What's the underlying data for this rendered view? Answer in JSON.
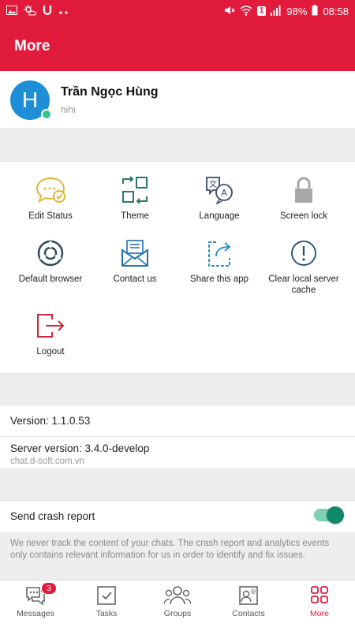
{
  "status_bar": {
    "battery": "98%",
    "time": "08:58",
    "sim_badge": "1",
    "left_icons": [
      "image-icon",
      "weather-icon",
      "u-icon",
      "more-dots-icon"
    ],
    "right_icons": [
      "mute-icon",
      "wifi-icon",
      "sim-icon",
      "signal-icon",
      "battery-icon"
    ]
  },
  "header": {
    "title": "More"
  },
  "profile": {
    "initial": "H",
    "name": "Trần Ngọc Hùng",
    "status": "hihi",
    "online": true
  },
  "menu": {
    "items": [
      {
        "label": "Edit Status",
        "icon": "chat-status-icon",
        "color": "#e0b43a"
      },
      {
        "label": "Theme",
        "icon": "theme-icon",
        "color": "#2a7a6a"
      },
      {
        "label": "Language",
        "icon": "language-icon",
        "color": "#3a4a6a"
      },
      {
        "label": "Screen lock",
        "icon": "lock-icon",
        "color": "#a8a8a8"
      },
      {
        "label": "Default browser",
        "icon": "browser-icon",
        "color": "#2c4a5a"
      },
      {
        "label": "Contact us",
        "icon": "mail-icon",
        "color": "#1f6fb5"
      },
      {
        "label": "Share this app",
        "icon": "share-icon",
        "color": "#2d8fc9"
      },
      {
        "label": "Clear local server cache",
        "icon": "info-icon",
        "color": "#1a4a7a"
      },
      {
        "label": "Logout",
        "icon": "logout-icon",
        "color": "#d0283c"
      }
    ]
  },
  "info": {
    "version": "Version: 1.1.0.53",
    "server_version": "Server version: 3.4.0-develop",
    "server_host": "chat.d-soft.com.vn"
  },
  "crash": {
    "label": "Send crash report",
    "enabled": true,
    "note": "We never track the content of your chats. The crash report and analytics events only contains relevant information for us in order to identify and fix issues."
  },
  "nav": {
    "items": [
      {
        "label": "Messages",
        "icon": "messages-icon",
        "badge": "3"
      },
      {
        "label": "Tasks",
        "icon": "tasks-icon"
      },
      {
        "label": "Groups",
        "icon": "groups-icon"
      },
      {
        "label": "Contacts",
        "icon": "contacts-icon"
      },
      {
        "label": "More",
        "icon": "more-grid-icon",
        "active": true
      }
    ]
  },
  "colors": {
    "brand": "#e01b3c",
    "toggle_on": "#10896a",
    "avatar": "#1e8fd6"
  }
}
